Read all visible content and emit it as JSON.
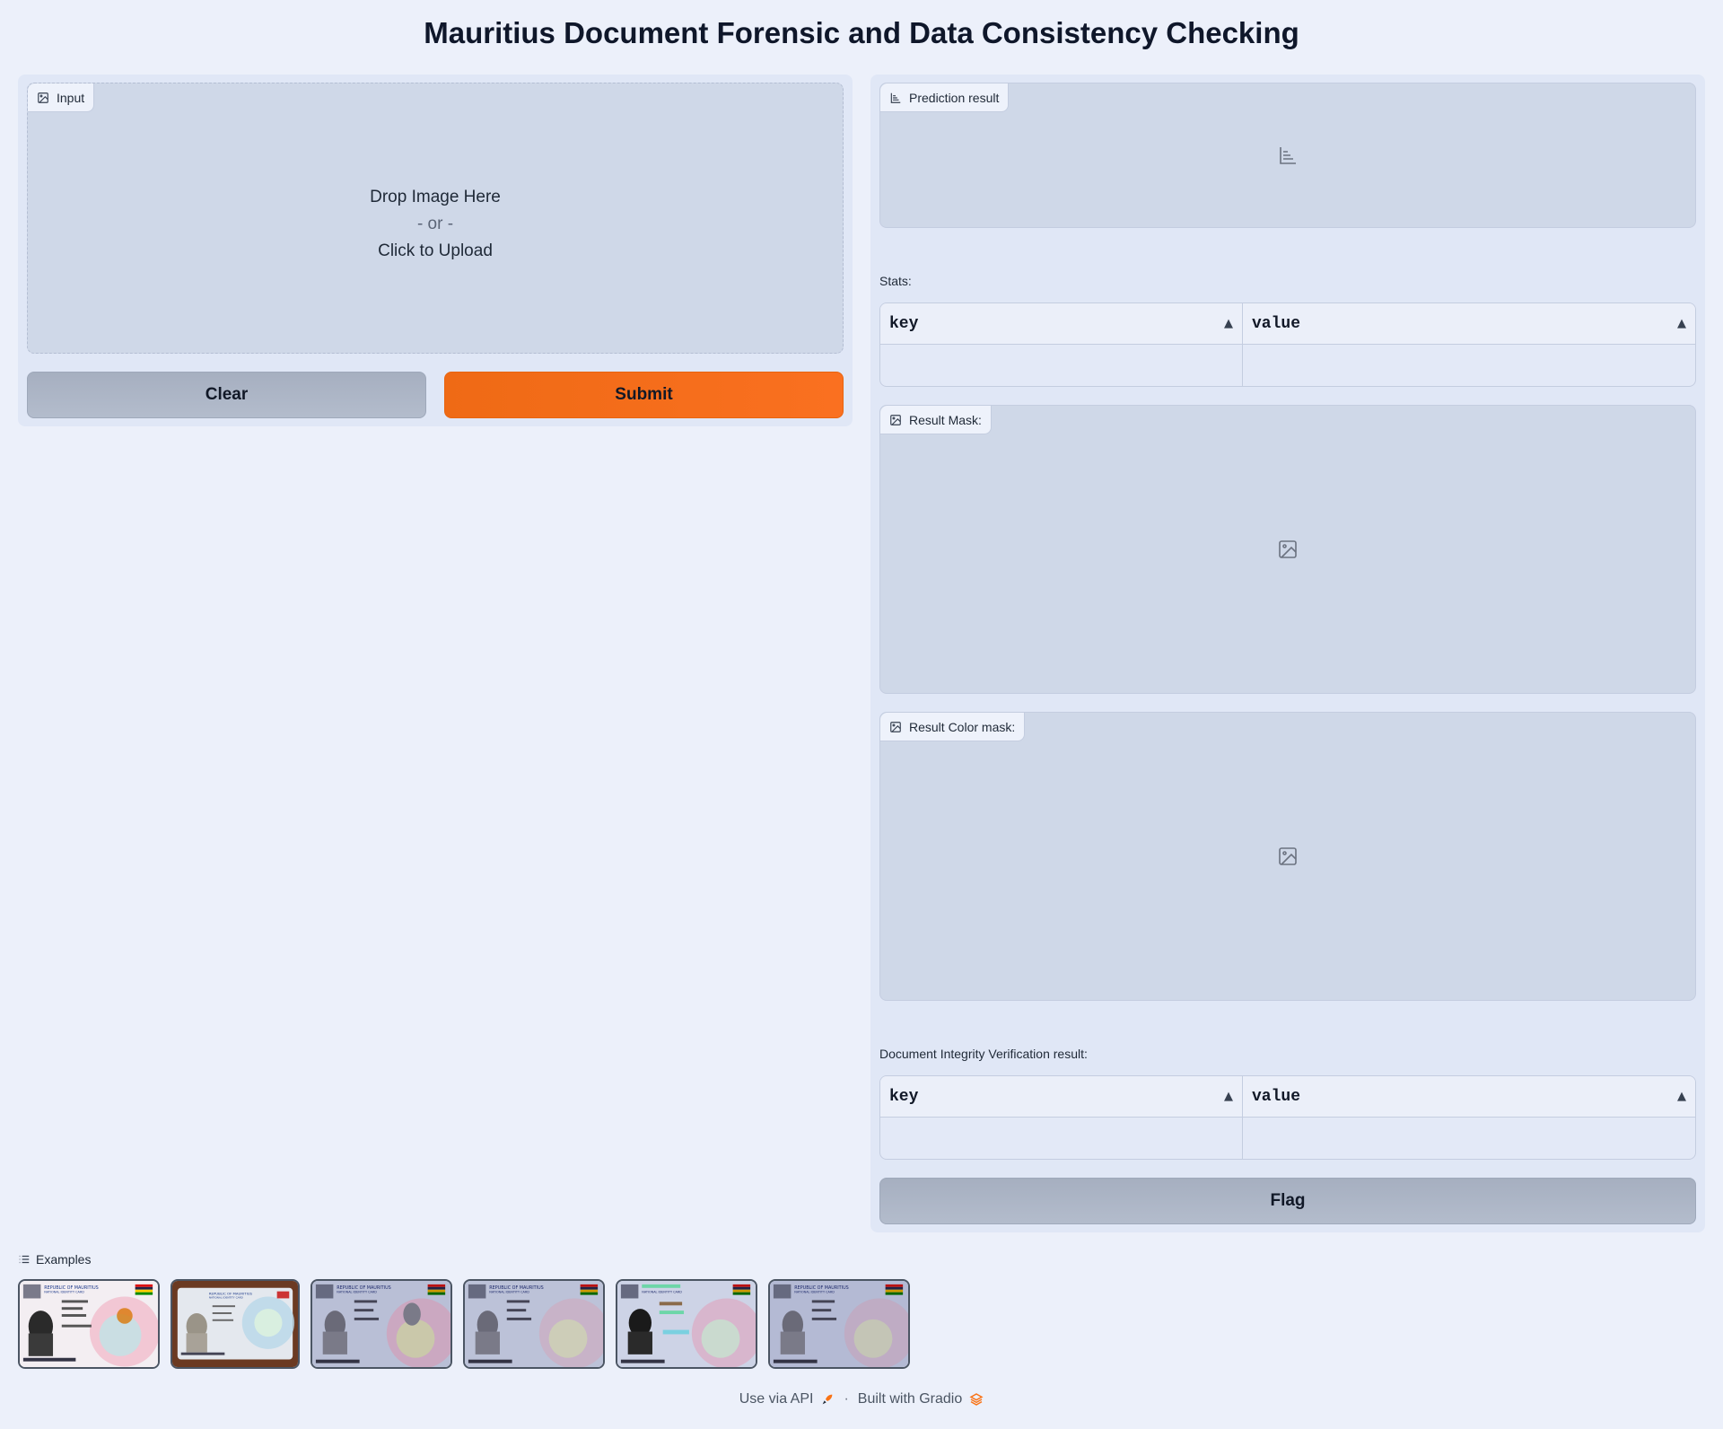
{
  "page": {
    "title": "Mauritius Document Forensic and Data Consistency Checking"
  },
  "input": {
    "label": "Input",
    "drop_text": "Drop Image Here",
    "or_text": "- or -",
    "click_text": "Click to Upload"
  },
  "buttons": {
    "clear": "Clear",
    "submit": "Submit",
    "flag": "Flag"
  },
  "outputs": {
    "prediction_label": "Prediction result",
    "stats_label": "Stats:",
    "stats_headers": [
      "key",
      "value"
    ],
    "mask_label": "Result Mask:",
    "color_mask_label": "Result Color mask:",
    "integrity_label": "Document Integrity Verification result:",
    "integrity_headers": [
      "key",
      "value"
    ]
  },
  "examples": {
    "label": "Examples",
    "cards": [
      {
        "country": "REPUBLIC OF MAURITIUS",
        "card": "NATIONAL IDENTITY CARD"
      },
      {
        "country": "REPUBLIC OF MAURITIUS",
        "card": "NATIONAL IDENTITY CARD"
      },
      {
        "country": "REPUBLIC OF MAURITIUS",
        "card": "NATIONAL IDENTITY CARD"
      },
      {
        "country": "REPUBLIC OF MAURITIUS",
        "card": "NATIONAL IDENTITY CARD"
      },
      {
        "country": "REPUBLIC OF MAURITIUS",
        "card": "NATIONAL IDENTITY CARD"
      },
      {
        "country": "REPUBLIC OF MAURITIUS",
        "card": "NATIONAL IDENTITY CARD"
      }
    ]
  },
  "footer": {
    "api": "Use via API",
    "separator": "·",
    "built": "Built with Gradio"
  },
  "colors": {
    "accent": "#f97316",
    "background": "#ecf0fa",
    "panel": "#e0e7f6",
    "block": "#cfd8e8"
  },
  "icons": {
    "input": "image-icon",
    "prediction": "bar-chart-icon",
    "mask": "image-icon",
    "examples": "list-icon",
    "api": "rocket-icon",
    "gradio": "gradio-logo-icon"
  }
}
